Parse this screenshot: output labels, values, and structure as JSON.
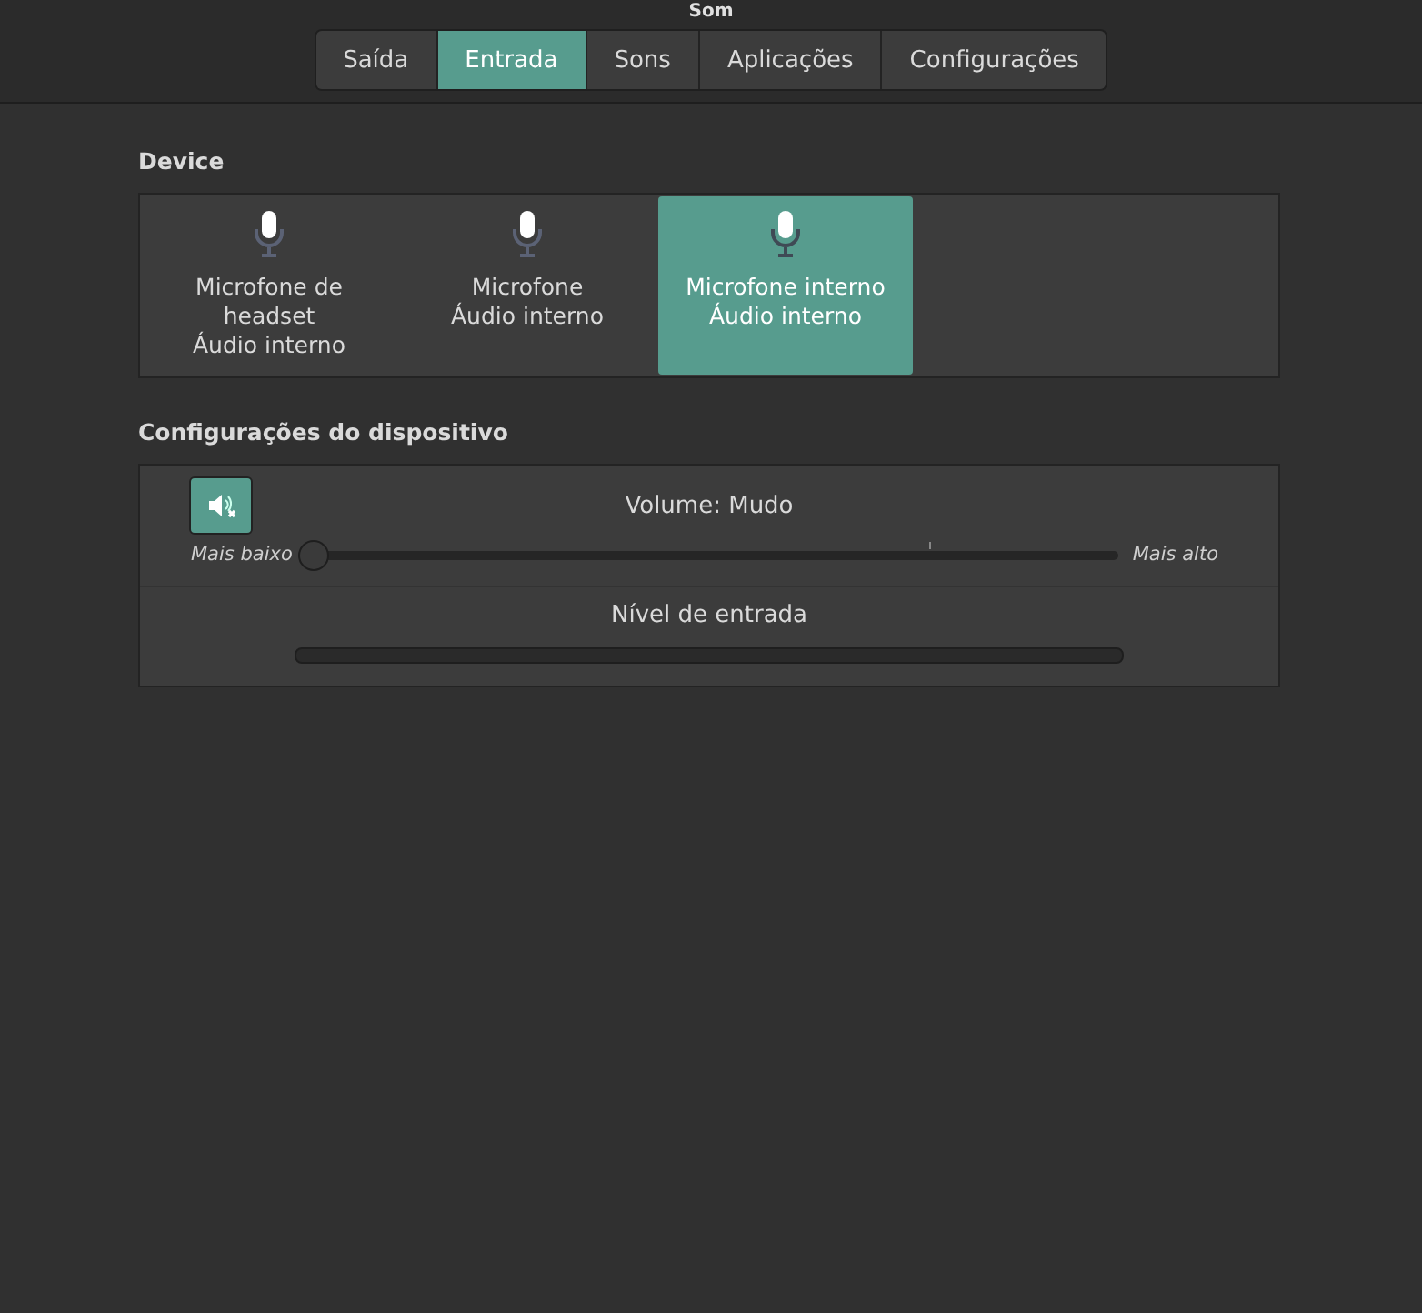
{
  "window": {
    "title": "Som"
  },
  "tabs": [
    {
      "label": "Saída",
      "selected": false
    },
    {
      "label": "Entrada",
      "selected": true
    },
    {
      "label": "Sons",
      "selected": false
    },
    {
      "label": "Aplicações",
      "selected": false
    },
    {
      "label": "Configurações",
      "selected": false
    }
  ],
  "device_section": {
    "heading": "Device",
    "devices": [
      {
        "lines": [
          "Microfone de",
          "headset",
          "Áudio interno"
        ],
        "selected": false
      },
      {
        "lines": [
          "Microfone",
          "Áudio interno"
        ],
        "selected": false
      },
      {
        "lines": [
          "Microfone interno",
          "Áudio interno"
        ],
        "selected": true
      }
    ]
  },
  "settings_section": {
    "heading": "Configurações do dispositivo",
    "mute_button": {
      "on": true
    },
    "volume_label": "Volume: Mudo",
    "volume_slider": {
      "min_label": "Mais baixo",
      "max_label": "Mais alto",
      "level": 0
    },
    "input_level": {
      "label": "Nível de entrada",
      "level": 0
    }
  }
}
